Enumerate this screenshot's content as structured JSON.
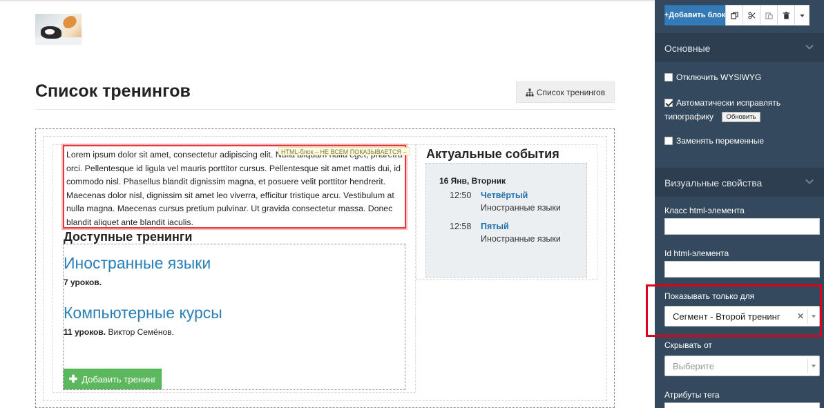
{
  "editor": {
    "page_title": "Список тренингов",
    "title_button_label": "Список тренингов",
    "html_block": {
      "tag_label": "HTML-блок – НЕ ВСЕМ ПОКАЗЫВАЕТСЯ –",
      "text": "Lorem ipsum dolor sit amet, consectetur adipiscing elit. Nulla aliquam nulla eget, pharetra orci. Pellentesque id ligula vel mauris porttitor cursus. Pellentesque sit amet mattis dui, id commodo nisl. Phasellus blandit dignissim magna, et posuere velit porttitor hendrerit. Maecenas dolor nisl, dignissim sit amet leo viverra, efficitur tristique arcu. Vestibulum at nulla magna. Maecenas cursus pretium pulvinar. Ut gravida consectetur massa. Donec blandit aliquet ante blandit iaculis."
    },
    "trainings": {
      "title": "Доступные тренинги",
      "items": [
        {
          "name": "Иностранные языки",
          "lessons": "7 уроков.",
          "author": ""
        },
        {
          "name": "Компьютерные курсы",
          "lessons": "11 уроков.",
          "author": "Виктор Семёнов."
        }
      ],
      "add_label": "Добавить тренинг"
    },
    "events": {
      "title": "Актуальные события",
      "date": "16 Янв, Вторник",
      "items": [
        {
          "time": "12:50",
          "title": "Четвёртый",
          "subtitle": "Иностранные языки"
        },
        {
          "time": "12:58",
          "title": "Пятый",
          "subtitle": "Иностранные языки"
        }
      ]
    }
  },
  "sidebar": {
    "toolbar": {
      "add_block_label": "+Добавить блок",
      "icons": [
        "copy-icon",
        "cut-icon",
        "paste-icon",
        "trash-icon",
        "caret-down-icon"
      ]
    },
    "basic_section": {
      "title": "Основные",
      "disable_wysiwyg": {
        "label": "Отключить WYSIWYG",
        "checked": false
      },
      "auto_typography": {
        "label_line1": "Автоматически исправлять",
        "label_line2": "типографику",
        "checked": true,
        "refresh_label": "Обновить"
      },
      "replace_variables": {
        "label": "Заменять переменные",
        "checked": false
      }
    },
    "visual_section": {
      "title": "Визуальные свойства",
      "class_label": "Класс html-элемента",
      "class_value": "",
      "id_label": "Id html-элемента",
      "id_value": "",
      "show_only_label": "Показывать только для",
      "show_only_value": "Сегмент - Второй тренинг",
      "hide_from_label": "Скрывать от",
      "hide_from_placeholder": "Выберите",
      "tag_attrs_label": "Атрибуты тега"
    }
  },
  "colors": {
    "sidebar_bg": "#34495e",
    "sidebar_header_bg": "#2c3e50",
    "primary": "#337ab7",
    "success": "#5cb85c",
    "link": "#2a7fb8",
    "highlight": "#e0001a"
  }
}
